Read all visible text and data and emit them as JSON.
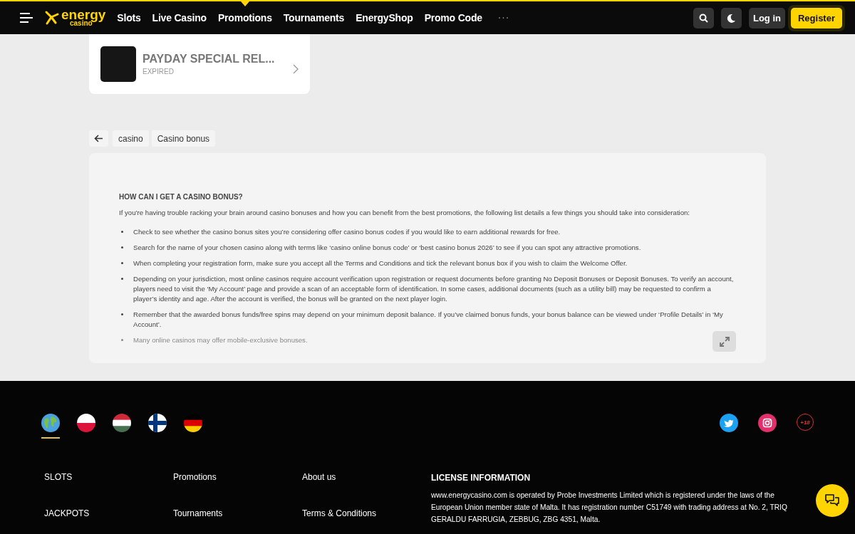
{
  "header": {
    "logo_word": "energy",
    "logo_sub": "casino",
    "nav": [
      {
        "label": "Slots",
        "selected": false
      },
      {
        "label": "Live Casino",
        "selected": false
      },
      {
        "label": "Promotions",
        "selected": true
      },
      {
        "label": "Tournaments",
        "selected": false
      },
      {
        "label": "EnergyShop",
        "selected": false
      },
      {
        "label": "Promo Code",
        "selected": false
      }
    ],
    "more": "···",
    "login": "Log in",
    "register": "Register"
  },
  "promo": {
    "title": "PAYDAY SPECIAL REL...",
    "status": "EXPIRED"
  },
  "breadcrumb": [
    "casino",
    "Casino bonus"
  ],
  "article": {
    "heading": "HOW CAN I GET A CASINO BONUS?",
    "intro": "If you’re having trouble racking your brain around casino bonuses and how you can benefit from the best promotions, the following list details a few things you should take into consideration:",
    "bullets": [
      {
        "text": "Check to see whether the casino bonus sites you’re considering offer casino bonus codes if you would like to earn additional rewards for free.",
        "faded": false
      },
      {
        "text": "Search for the name of your chosen casino along with terms like ‘casino online bonus code’ or ‘best casino bonus 2026’ to see if you can spot any attractive promotions.",
        "faded": false
      },
      {
        "text": "When completing your registration form, make sure you accept all the Terms and Conditions and tick the relevant bonus box if you wish to claim the Welcome Offer.",
        "faded": false
      },
      {
        "text": "Depending on your jurisdiction, most online casinos require account verification upon registration or request documents before granting No Deposit Bonuses or Deposit Bonuses. To verify an account, players need to visit the ‘My Account’ page and provide a scan of an acceptable form of identification. In some cases, additional documents (such as a utility bill) may be requested to confirm a player’s identity and age. After the account is verified, the bonus will be granted on the next player login.",
        "faded": false
      },
      {
        "text": "Remember that the awarded bonus funds/free spins may depend on your minimum deposit balance. If you’ve claimed bonus funds, your bonus balance can be viewed under ‘Profile Details’ in ‘My Account’.",
        "faded": false
      },
      {
        "text": "Many online casinos may offer mobile-exclusive bonuses.",
        "faded": true
      }
    ]
  },
  "footer": {
    "languages": [
      {
        "kind": "globe",
        "selected": true
      },
      {
        "kind": "poland",
        "selected": false
      },
      {
        "kind": "hungary",
        "selected": false
      },
      {
        "kind": "finland",
        "selected": false
      },
      {
        "kind": "germany",
        "selected": false
      }
    ],
    "age_badge": "+18",
    "links": [
      [
        "SLOTS",
        "JACKPOTS"
      ],
      [
        "Promotions",
        "Tournaments"
      ],
      [
        "About us",
        "Terms & Conditions"
      ]
    ],
    "license_title": "LICENSE INFORMATION",
    "license_text": "www.energycasino.com is operated by Probe Investments Limited which is registered under the laws of the European Union member state of Malta. It has registration number C51749 with trading address at No. 2, TRIQ GERALDU FARRUGIA, ZEBBUG, ZBG 4351, Malta."
  }
}
